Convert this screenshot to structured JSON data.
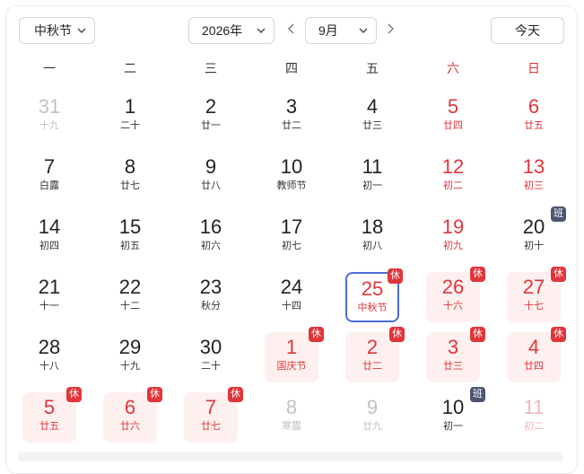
{
  "toolbar": {
    "holiday_select": "中秋节",
    "year_select": "2026年",
    "month_select": "9月",
    "today_label": "今天"
  },
  "weekdays": [
    "一",
    "二",
    "三",
    "四",
    "五",
    "六",
    "日"
  ],
  "rows": [
    [
      {
        "day": "31",
        "sub": "十九",
        "state": "other"
      },
      {
        "day": "1",
        "sub": "二十"
      },
      {
        "day": "2",
        "sub": "廿一"
      },
      {
        "day": "3",
        "sub": "廿二"
      },
      {
        "day": "4",
        "sub": "廿三"
      },
      {
        "day": "5",
        "sub": "廿四",
        "weekend": true
      },
      {
        "day": "6",
        "sub": "廿五",
        "weekend": true
      }
    ],
    [
      {
        "day": "7",
        "sub": "白露"
      },
      {
        "day": "8",
        "sub": "廿七"
      },
      {
        "day": "9",
        "sub": "廿八"
      },
      {
        "day": "10",
        "sub": "教师节"
      },
      {
        "day": "11",
        "sub": "初一"
      },
      {
        "day": "12",
        "sub": "初二",
        "weekend": true
      },
      {
        "day": "13",
        "sub": "初三",
        "weekend": true
      }
    ],
    [
      {
        "day": "14",
        "sub": "初四"
      },
      {
        "day": "15",
        "sub": "初五"
      },
      {
        "day": "16",
        "sub": "初六"
      },
      {
        "day": "17",
        "sub": "初七"
      },
      {
        "day": "18",
        "sub": "初八"
      },
      {
        "day": "19",
        "sub": "初九",
        "weekend": true
      },
      {
        "day": "20",
        "sub": "初十",
        "badge": "班"
      }
    ],
    [
      {
        "day": "21",
        "sub": "十一"
      },
      {
        "day": "22",
        "sub": "十二"
      },
      {
        "day": "23",
        "sub": "秋分"
      },
      {
        "day": "24",
        "sub": "十四"
      },
      {
        "day": "25",
        "sub": "中秋节",
        "state": "selected",
        "badge": "休"
      },
      {
        "day": "26",
        "sub": "十六",
        "state": "holiday",
        "badge": "休"
      },
      {
        "day": "27",
        "sub": "十七",
        "state": "holiday",
        "badge": "休"
      }
    ],
    [
      {
        "day": "28",
        "sub": "十八"
      },
      {
        "day": "29",
        "sub": "十九"
      },
      {
        "day": "30",
        "sub": "二十"
      },
      {
        "day": "1",
        "sub": "国庆节",
        "state": "holiday",
        "badge": "休"
      },
      {
        "day": "2",
        "sub": "廿二",
        "state": "holiday",
        "badge": "休"
      },
      {
        "day": "3",
        "sub": "廿三",
        "state": "holiday",
        "badge": "休"
      },
      {
        "day": "4",
        "sub": "廿四",
        "state": "holiday",
        "badge": "休"
      }
    ],
    [
      {
        "day": "5",
        "sub": "廿五",
        "state": "holiday",
        "badge": "休"
      },
      {
        "day": "6",
        "sub": "廿六",
        "state": "holiday",
        "badge": "休"
      },
      {
        "day": "7",
        "sub": "廿七",
        "state": "holiday",
        "badge": "休"
      },
      {
        "day": "8",
        "sub": "寒露",
        "state": "other"
      },
      {
        "day": "9",
        "sub": "廿九",
        "state": "other"
      },
      {
        "day": "10",
        "sub": "初一",
        "badge": "班"
      },
      {
        "day": "11",
        "sub": "初二",
        "state": "other",
        "weekend": true
      }
    ]
  ],
  "colors": {
    "accent_red": "#e0353a",
    "holiday_bg": "#fdf0ef",
    "selected_border": "#4a6cd9",
    "work_badge": "#4c5570"
  }
}
